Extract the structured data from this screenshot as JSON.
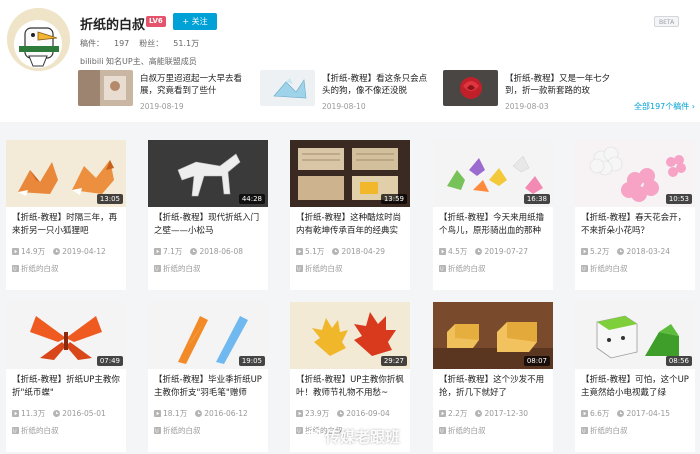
{
  "profile": {
    "username": "折纸的白叔",
    "lv_badge": "LV6",
    "follow_label": "+ 关注",
    "beta_label": "BETA",
    "works_label": "稿件：",
    "works_count": "197",
    "fans_label": "粉丝：",
    "fans_count": "51.1万",
    "verification": "bilibili 知名UP主、高能联盟成员"
  },
  "recent": [
    {
      "title": "白叔万里迢迢起一大早去看展，究竟看到了些什",
      "date": "2019-08-19"
    },
    {
      "title": "【折纸-教程】看这条只会点头的狗，像不像还没脱",
      "date": "2019-08-10"
    },
    {
      "title": "【折纸-教程】又是一年七夕到，折一款新套路的玫",
      "date": "2019-08-03"
    }
  ],
  "all_videos_link": "全部197个稿件 ›",
  "videos": [
    {
      "title": "【折纸-教程】时隔三年，再来折另一只小狐狸吧",
      "duration": "13:05",
      "views": "14.9万",
      "date": "2019-04-12",
      "uploader": "折纸的白叔"
    },
    {
      "title": "【折纸-教程】现代折纸入门之壁——小松马",
      "duration": "44:28",
      "views": "7.1万",
      "date": "2018-06-08",
      "uploader": "折纸的白叔"
    },
    {
      "title": "【折纸-教程】这种酷炫时尚内有乾坤传承百年的经典实",
      "duration": "13:59",
      "views": "5.1万",
      "date": "2018-04-29",
      "uploader": "折纸的白叔"
    },
    {
      "title": "【折纸-教程】今天来用纸撸个鸟儿，原形骑出血的那种",
      "duration": "16:38",
      "views": "4.5万",
      "date": "2019-07-27",
      "uploader": "折纸的白叔"
    },
    {
      "title": "【折纸-教程】春天花会开，不来折朵小花吗？",
      "duration": "10:53",
      "views": "5.2万",
      "date": "2018-03-24",
      "uploader": "折纸的白叔"
    },
    {
      "title": "【折纸-教程】折纸UP主教你折\"纸币蝶\"",
      "duration": "07:49",
      "views": "11.3万",
      "date": "2016-05-01",
      "uploader": "折纸的白叔"
    },
    {
      "title": "【折纸-教程】毕业季折纸UP主教你折支\"羽毛笔\"赠师",
      "duration": "19:05",
      "views": "18.1万",
      "date": "2016-06-12",
      "uploader": "折纸的白叔"
    },
    {
      "title": "【折纸-教程】UP主教你折枫叶！教师节礼物不用愁~",
      "duration": "29:27",
      "views": "23.9万",
      "date": "2016-09-04",
      "uploader": "折纸的白叔"
    },
    {
      "title": "【折纸-教程】这个沙发不用抢，折几下就好了",
      "duration": "08:07",
      "views": "2.2万",
      "date": "2017-12-30",
      "uploader": "折纸的白叔"
    },
    {
      "title": "【折纸-教程】可怕，这个UP主竟然给小电视戴了绿",
      "duration": "08:56",
      "views": "6.6万",
      "date": "2017-04-15",
      "uploader": "折纸的白叔"
    }
  ],
  "watermark": "传媒老跟班",
  "colors": {
    "accent": "#00a1d6",
    "badge": "#e4526b",
    "tag_red": "#e4526b"
  }
}
